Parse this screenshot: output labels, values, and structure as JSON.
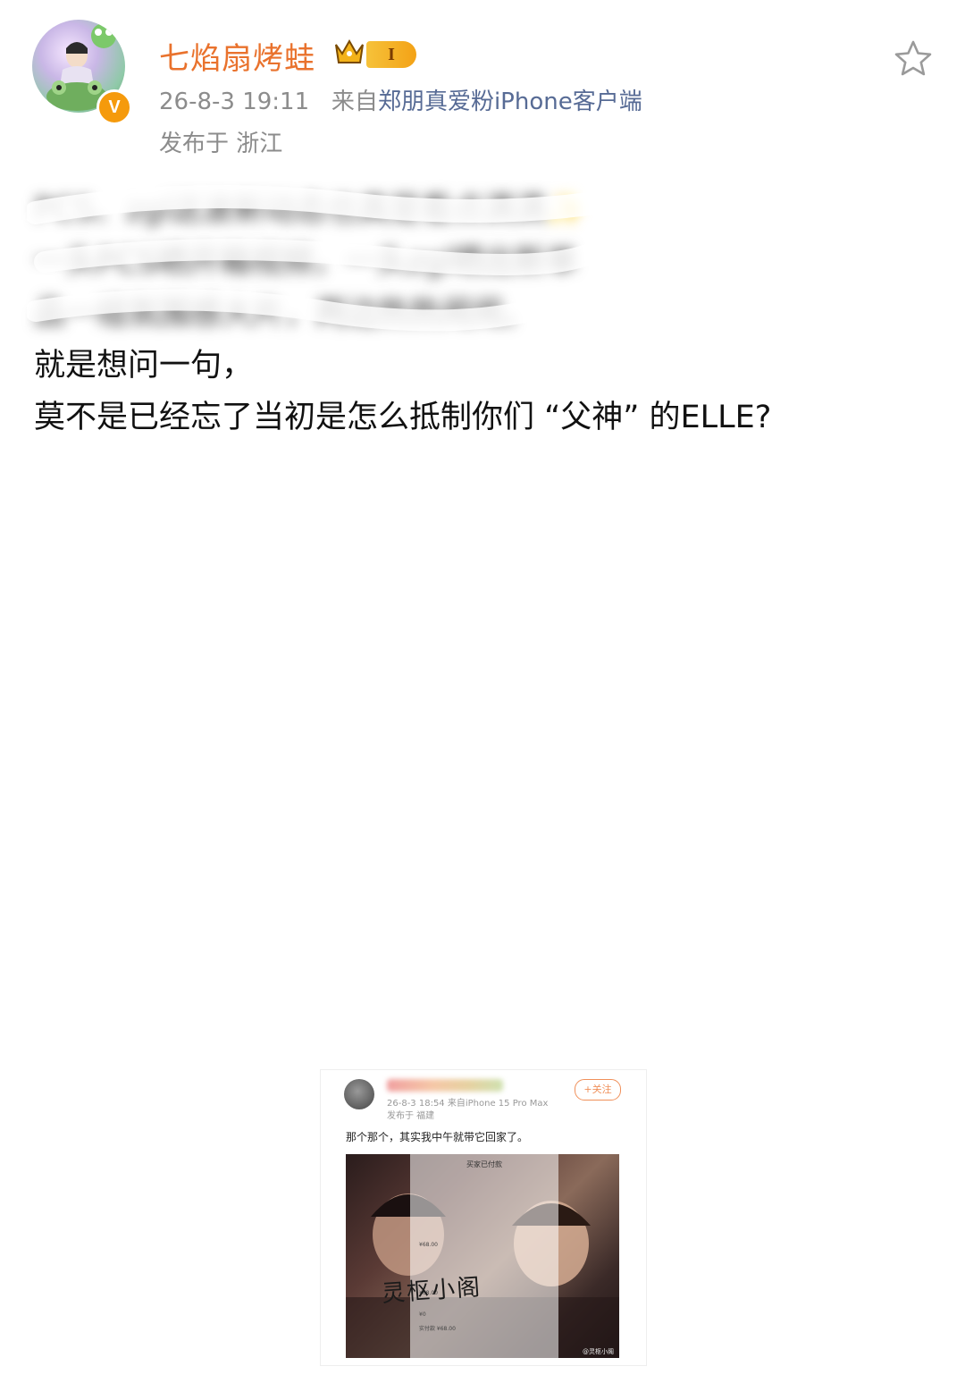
{
  "post": {
    "username": "七焰扇烤蛙",
    "level_badge": "I",
    "verified_badge": "V",
    "timestamp": "26-8-3 19:11",
    "source_prefix": "来自",
    "source": "郑朋真爱粉iPhone客户端",
    "location": "发布于 浙江",
    "content_lines": [
      "PCS、zgl这波新动态也真是看点满满✨",
      "一头PCS晒开箱视频，一头zgl晒出新单",
      "品一组氛围感大片，两边热热闹闹。",
      "就是想问一句，",
      "莫不是已经忘了当初是怎么抵制你们 “父神” 的ELLE?"
    ]
  },
  "embedded_post": {
    "timestamp": "26-8-3 18:54",
    "source": "来自iPhone 15 Pro Max",
    "location": "发布于 福建",
    "follow_label": "+关注",
    "text": "那个那个，其实我中午就带它回家了。",
    "overlay_title": "买家已付款",
    "overlay_prices": [
      "¥68.00",
      "¥68.00",
      "¥0",
      "实付款 ¥68.00"
    ],
    "calligraphy": "灵枢小阁",
    "watermark": "@灵枢小阁"
  },
  "colors": {
    "username": "#e9722d",
    "source_link": "#576b95",
    "meta_gray": "#8c8c8c",
    "badge_orange": "#f59a0c"
  },
  "icons": {
    "favorite": "star-outline-icon",
    "crown": "crown-icon",
    "verified": "verified-v-icon"
  }
}
